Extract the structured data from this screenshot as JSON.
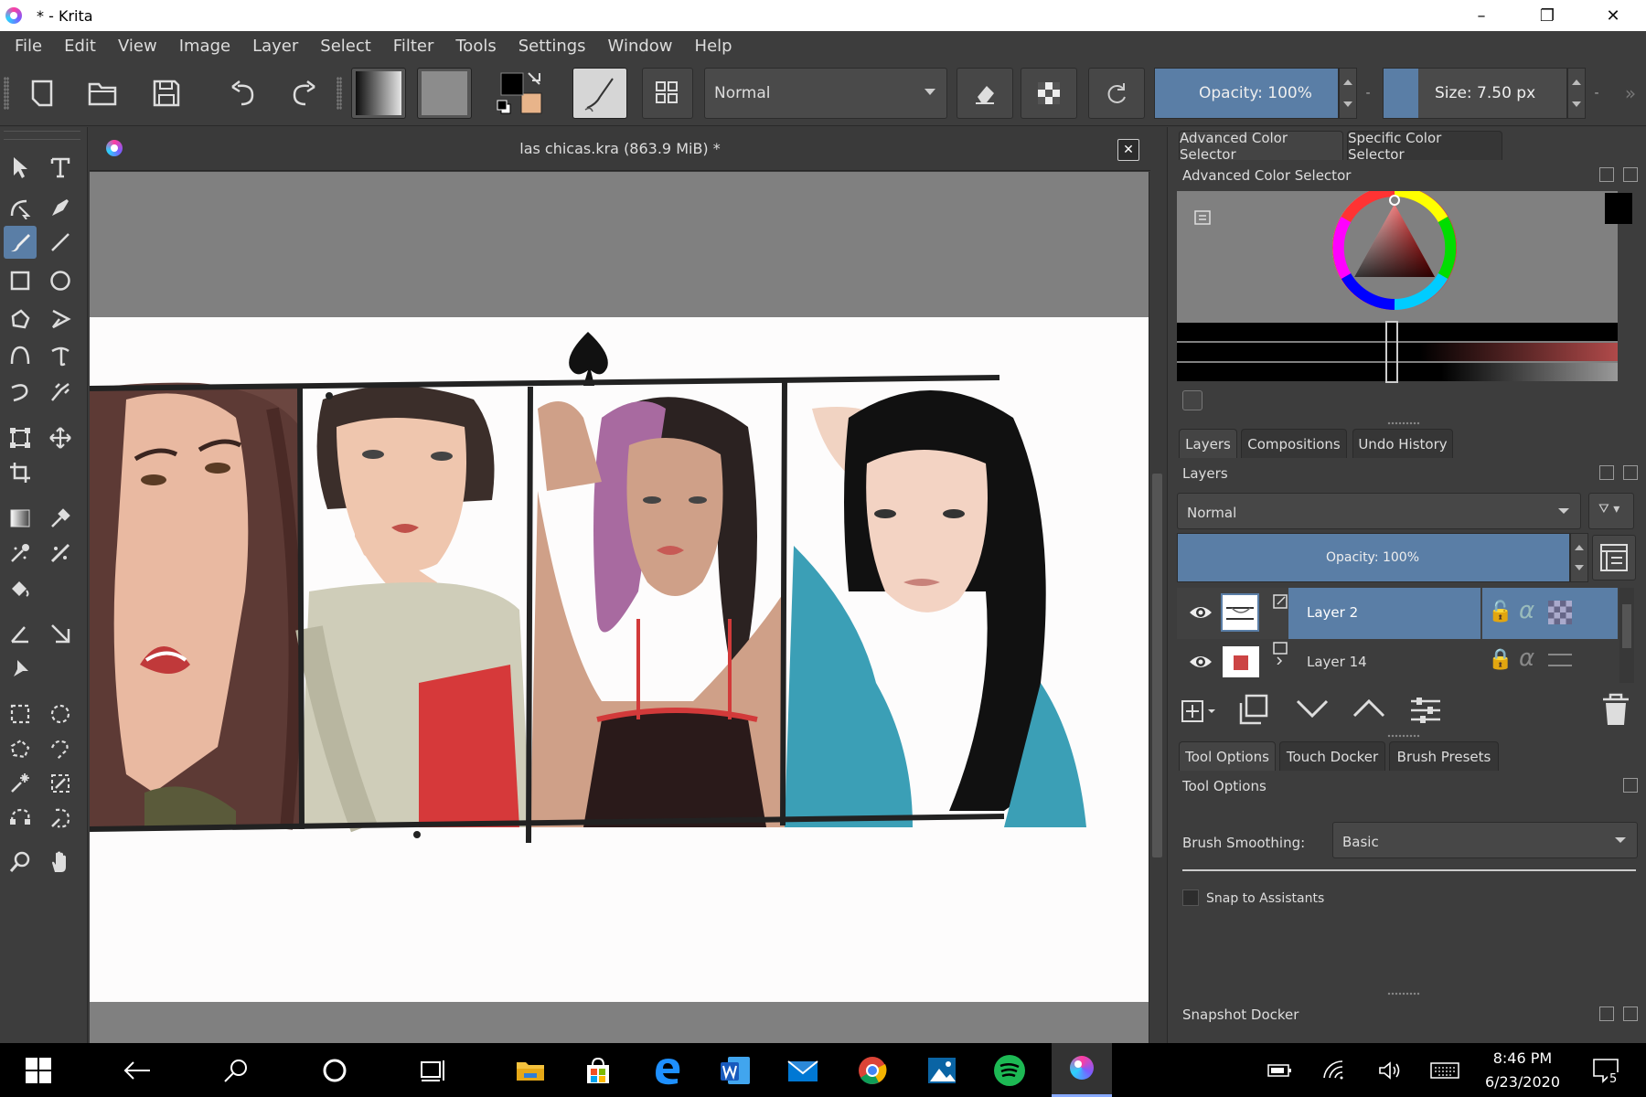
{
  "window": {
    "title": "* - Krita",
    "controls": [
      "–",
      "❐",
      "✕"
    ]
  },
  "menu": [
    "File",
    "Edit",
    "View",
    "Image",
    "Layer",
    "Select",
    "Filter",
    "Tools",
    "Settings",
    "Window",
    "Help"
  ],
  "toolbar": {
    "blend_mode": "Normal",
    "opacity": "Opacity: 100%",
    "opacity_value": 1.0,
    "size": "Size: 7.50 px"
  },
  "document": {
    "tab_title": "las chicas.kra (863.9 MiB) *",
    "close_label": "✕"
  },
  "color_docker": {
    "tabs": [
      "Advanced Color Selector",
      "Specific Color Selector"
    ],
    "title": "Advanced Color Selector"
  },
  "layers_docker": {
    "tabs": [
      "Layers",
      "Compositions",
      "Undo History"
    ],
    "title": "Layers",
    "blend_mode": "Normal",
    "opacity": "Opacity:  100%",
    "layers": [
      {
        "name": "Layer 2",
        "selected": true
      },
      {
        "name": "Layer 14",
        "selected": false
      }
    ]
  },
  "tool_docker": {
    "tabs": [
      "Tool Options",
      "Touch Docker",
      "Brush Presets"
    ],
    "title": "Tool Options",
    "brush_smoothing_label": "Brush Smoothing:",
    "brush_smoothing_value": "Basic",
    "snap_label": "Snap to Assistants"
  },
  "snapshot_docker": {
    "title": "Snapshot Docker"
  },
  "taskbar": {
    "time": "8:46 PM",
    "date": "6/23/2020",
    "notifications": "5"
  },
  "colors": {
    "accent": "#5a7ea6",
    "panel": "#3d3d3d",
    "foreground_color": "#000000",
    "background_color": "#e8b48a"
  }
}
